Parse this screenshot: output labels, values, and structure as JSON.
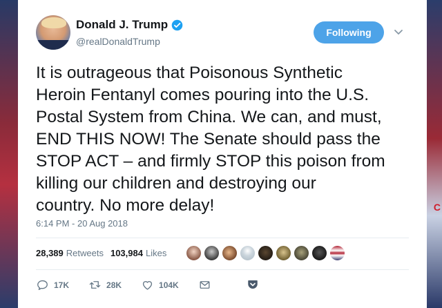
{
  "tweet": {
    "author_name": "Donald J. Trump",
    "handle": "@realDonaldTrump",
    "follow_label": "Following",
    "text": "It is outrageous that Poisonous Synthetic\nHeroin Fentanyl comes pouring into the U.S.\nPostal System from China. We can, and must,\nEND THIS NOW! The Senate should pass the\nSTOP ACT – and firmly STOP this poison from\nkilling our children and destroying our\ncountry. No more delay!",
    "timestamp": "6:14 PM - 20 Aug 2018",
    "retweets_count": "28,389",
    "retweets_label": "Retweets",
    "likes_count": "103,984",
    "likes_label": "Likes",
    "actions": {
      "replies": "17K",
      "retweets": "28K",
      "likes": "104K"
    }
  },
  "colors": {
    "accent": "#4da3e8",
    "verified": "#1da1f2",
    "text": "#14171a",
    "muted": "#657786"
  },
  "icons": [
    "verified-badge-icon",
    "chevron-down-icon",
    "reply-icon",
    "retweet-icon",
    "like-icon",
    "message-icon",
    "pocket-icon"
  ]
}
